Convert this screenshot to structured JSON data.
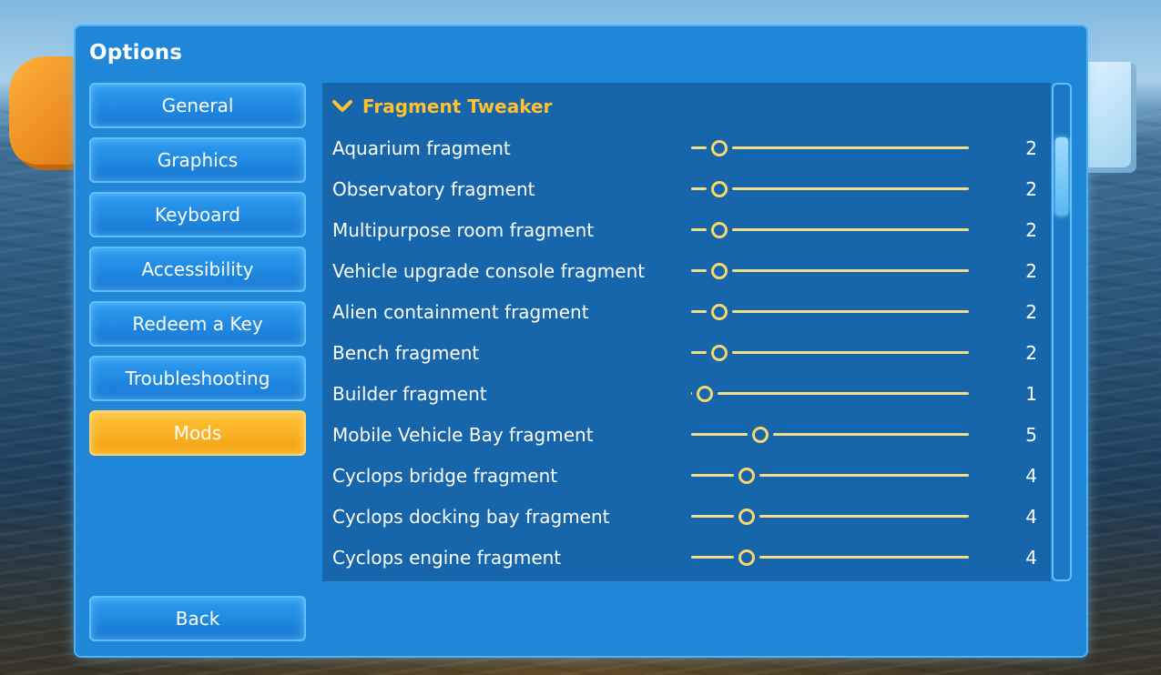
{
  "window": {
    "title": "Options"
  },
  "nav": {
    "items": [
      {
        "label": "General",
        "active": false
      },
      {
        "label": "Graphics",
        "active": false
      },
      {
        "label": "Keyboard",
        "active": false
      },
      {
        "label": "Accessibility",
        "active": false
      },
      {
        "label": "Redeem a Key",
        "active": false
      },
      {
        "label": "Troubleshooting",
        "active": false
      },
      {
        "label": "Mods",
        "active": true
      }
    ],
    "back_label": "Back"
  },
  "section": {
    "title": "Fragment Tweaker",
    "expanded_icon": "chevron-down-icon"
  },
  "settings": {
    "rows": [
      {
        "label": "Aquarium fragment",
        "value": "2",
        "fraction": 0.1
      },
      {
        "label": "Observatory fragment",
        "value": "2",
        "fraction": 0.1
      },
      {
        "label": "Multipurpose room fragment",
        "value": "2",
        "fraction": 0.1
      },
      {
        "label": "Vehicle upgrade console fragment",
        "value": "2",
        "fraction": 0.1
      },
      {
        "label": "Alien containment fragment",
        "value": "2",
        "fraction": 0.1
      },
      {
        "label": "Bench fragment",
        "value": "2",
        "fraction": 0.1
      },
      {
        "label": "Builder fragment",
        "value": "1",
        "fraction": 0.05
      },
      {
        "label": "Mobile Vehicle Bay fragment",
        "value": "5",
        "fraction": 0.25
      },
      {
        "label": "Cyclops bridge fragment",
        "value": "4",
        "fraction": 0.2
      },
      {
        "label": "Cyclops docking bay fragment",
        "value": "4",
        "fraction": 0.2
      },
      {
        "label": "Cyclops engine fragment",
        "value": "4",
        "fraction": 0.2
      }
    ]
  },
  "colors": {
    "panel": "#1f86d8",
    "content": "#1765ab",
    "accent": "#ffc12e",
    "active_tab": "#f4a20f",
    "slider": "#f3dd86"
  }
}
